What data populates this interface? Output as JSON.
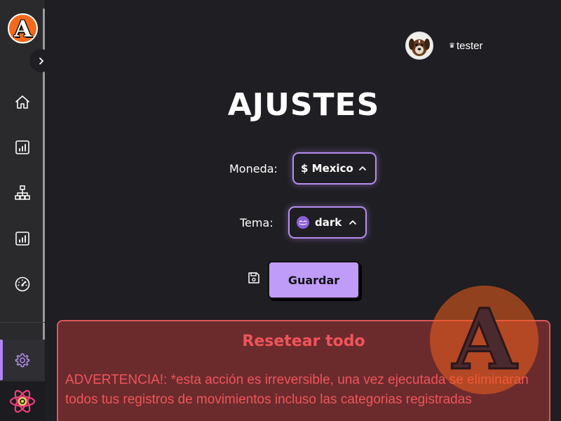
{
  "sidebar": {
    "logo_letter": "A",
    "expand_icon": "chevron-right-icon",
    "items": [
      {
        "name": "home",
        "icon": "home-icon"
      },
      {
        "name": "reports",
        "icon": "bar-chart-icon"
      },
      {
        "name": "categories",
        "icon": "sitemap-icon"
      },
      {
        "name": "stats",
        "icon": "bar-chart-icon"
      },
      {
        "name": "dashboard",
        "icon": "gauge-icon"
      },
      {
        "name": "settings",
        "icon": "gear-icon",
        "active": true
      }
    ],
    "bottom_icon": "react-icon"
  },
  "header": {
    "username": "tester",
    "user_icon": "crown-icon"
  },
  "main": {
    "title": "AJUSTES",
    "currency_label": "Moneda:",
    "currency_value": "$ Mexico",
    "theme_label": "Tema:",
    "theme_value": "dark",
    "save_label": "Guardar",
    "reset": {
      "title": "Resetear todo",
      "warning": "ADVERTENCIA!: *esta acción es irreversible, una vez ejecutada se eliminaran todos tus registros de movimientos incluso las categorias registradas"
    },
    "watermark_letter": "A"
  },
  "colors": {
    "accent": "#b58ef0",
    "button": "#c09cf9",
    "danger": "#f0545a",
    "danger_bg": "#6b2b2d",
    "logo": "#f36a1c",
    "background": "#1f1e22"
  }
}
